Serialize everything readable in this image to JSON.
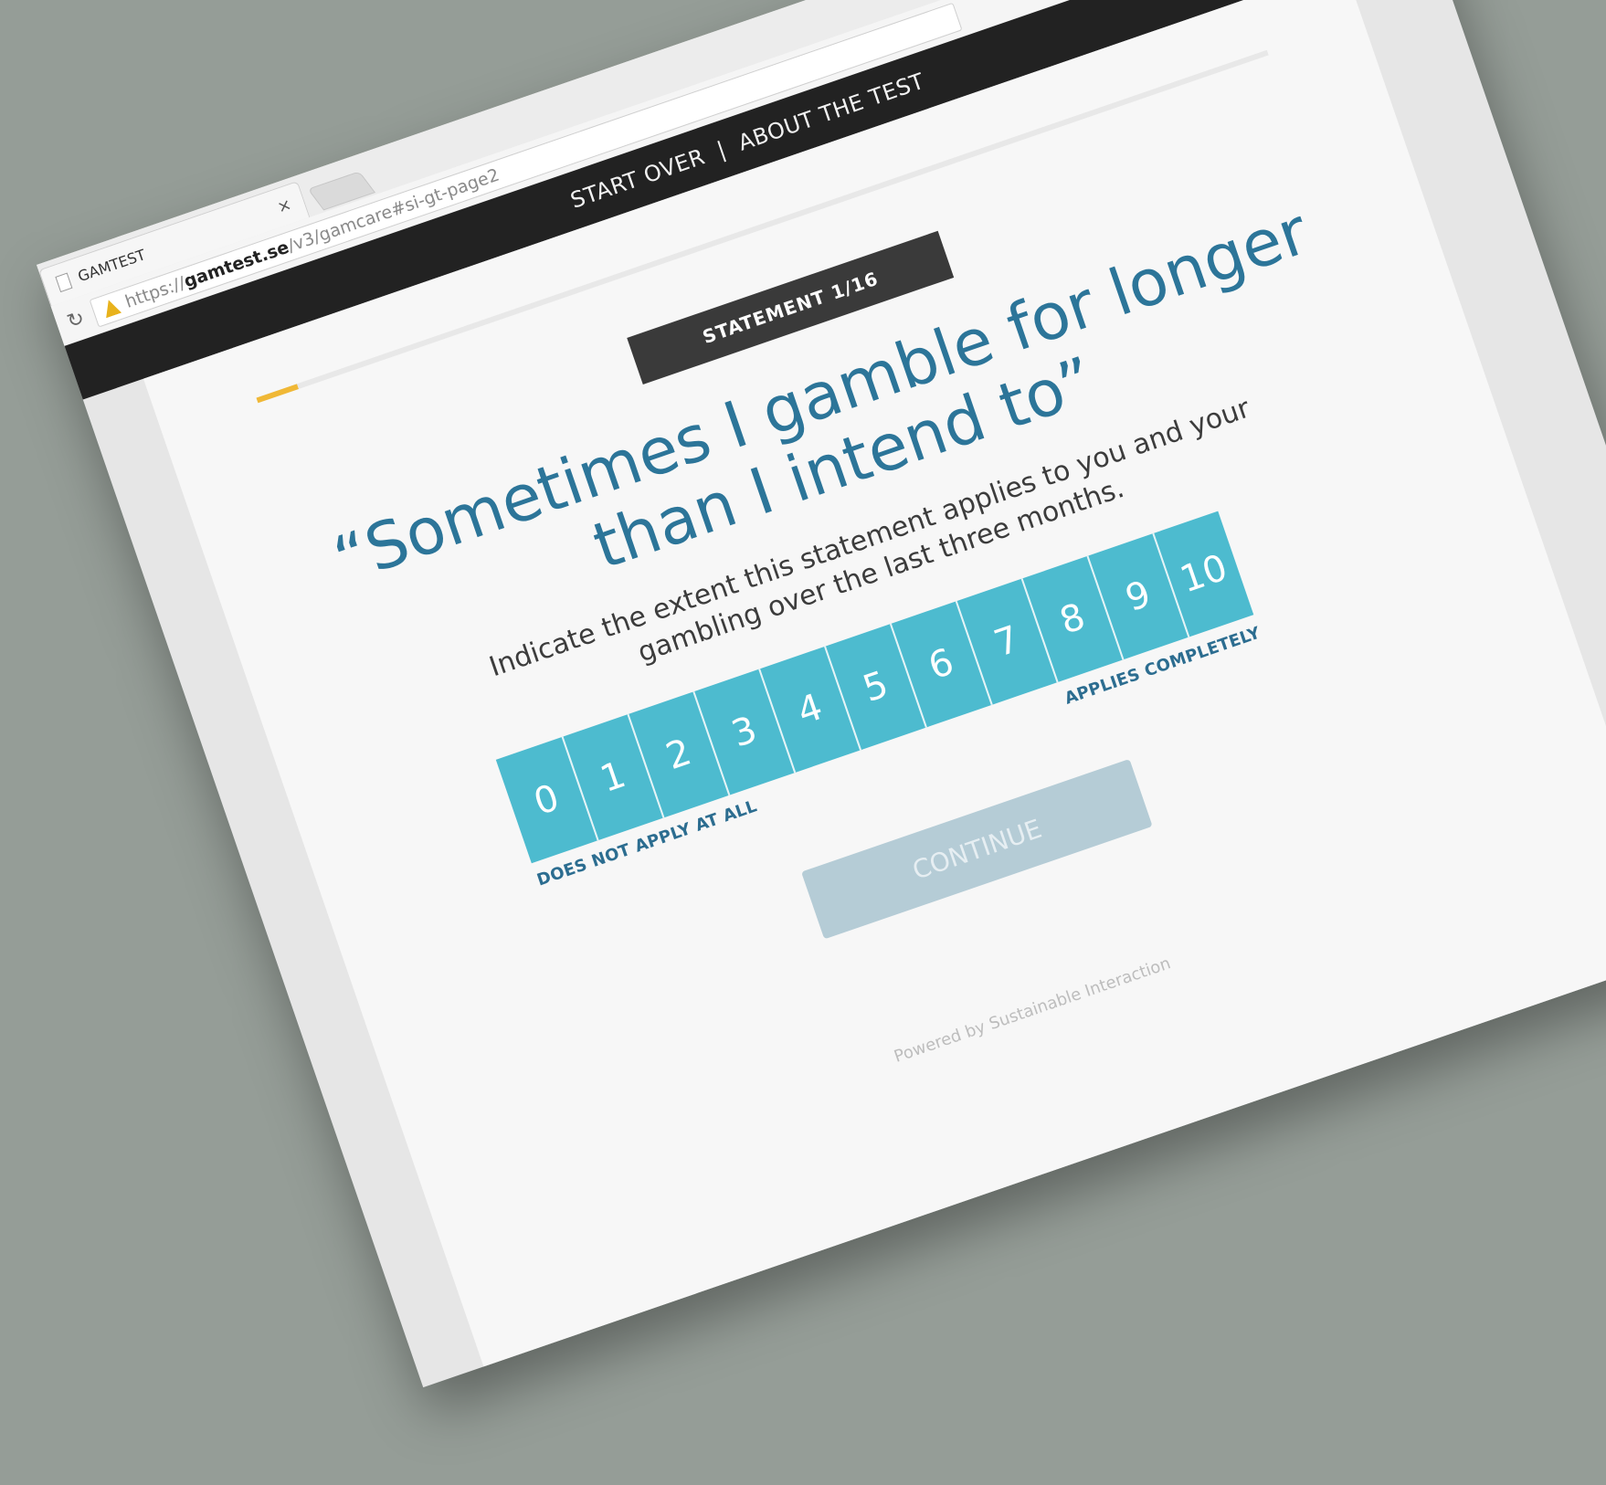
{
  "browser": {
    "tab_title": "GAMTEST",
    "tab_close": "×",
    "reload_icon": "↻",
    "url_scheme": "https://",
    "url_host": "gamtest.se",
    "url_path": "/v3/gamcare#si-gt-page2"
  },
  "nav": {
    "start_over": "START OVER",
    "separator": "|",
    "about": "ABOUT THE TEST"
  },
  "quiz": {
    "statement_badge": "STATEMENT 1/16",
    "progress": 0.04,
    "question": "“Sometimes I gamble for longer than I intend to”",
    "instruction": "Indicate the extent this statement applies to you and your gambling over the last three months.",
    "scale": [
      "0",
      "1",
      "2",
      "3",
      "4",
      "5",
      "6",
      "7",
      "8",
      "9",
      "10"
    ],
    "label_low": "DOES NOT APPLY AT ALL",
    "label_high": "APPLIES COMPLETELY",
    "continue_label": "CONTINUE"
  },
  "footer": {
    "text": "Powered by Sustainable Interaction"
  },
  "colors": {
    "accent_blue": "#2c7599",
    "scale_cyan": "#4dbbcf",
    "progress_yellow": "#f0b836",
    "disabled_button": "#b5ccd6"
  }
}
